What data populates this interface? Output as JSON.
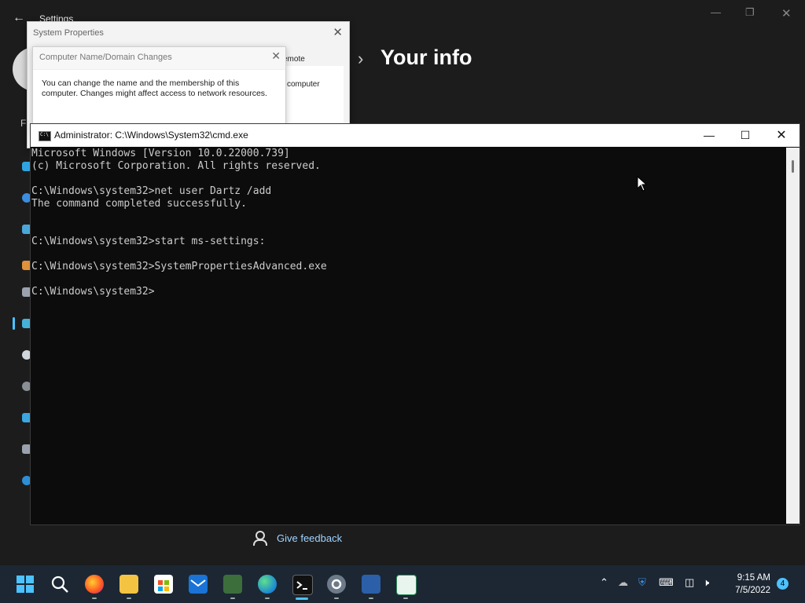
{
  "settings": {
    "title": "Settings",
    "heading": "Your info",
    "sidebar_letter": "F",
    "feedback_label": "Give feedback"
  },
  "system_properties": {
    "title": "System Properties",
    "tab_remote": "emote",
    "bg_text": "computer"
  },
  "domain_dialog": {
    "title": "Computer Name/Domain Changes",
    "message": "You can change the name and the membership of this computer. Changes might affect access to network resources."
  },
  "cmd": {
    "title": "Administrator: C:\\Windows\\System32\\cmd.exe",
    "lines": [
      "Microsoft Windows [Version 10.0.22000.739]",
      "(c) Microsoft Corporation. All rights reserved.",
      "",
      "C:\\Windows\\system32>net user Dartz /add",
      "The command completed successfully.",
      "",
      "",
      "C:\\Windows\\system32>start ms-settings:",
      "",
      "C:\\Windows\\system32>SystemPropertiesAdvanced.exe",
      "",
      "C:\\Windows\\system32>"
    ]
  },
  "taskbar": {
    "time": "9:15 AM",
    "date": "7/5/2022",
    "notification_count": "4",
    "apps": [
      "start",
      "search",
      "firefox",
      "file-explorer",
      "microsoft-store",
      "mail",
      "task-manager",
      "edge",
      "command-prompt",
      "settings",
      "remote-desktop",
      "notepad"
    ]
  },
  "colors": {
    "accent": "#4cc2ff",
    "console_bg": "#0c0c0c",
    "console_text": "#cccccc",
    "taskbar_bg": "#1c2733"
  }
}
